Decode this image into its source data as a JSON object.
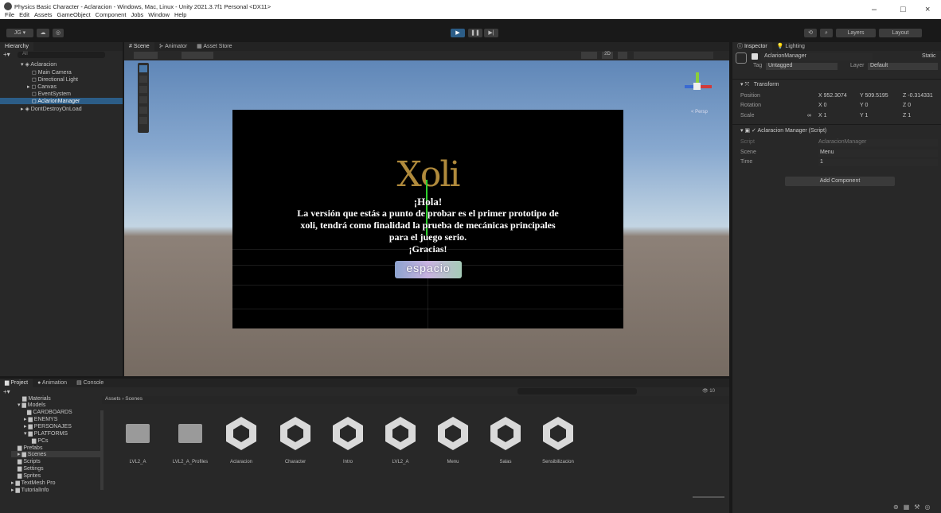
{
  "window": {
    "title": "Physics Basic Character - Aclaracion - Windows, Mac, Linux - Unity 2021.3.7f1 Personal <DX11>",
    "menu": [
      "File",
      "Edit",
      "Assets",
      "GameObject",
      "Component",
      "Jobs",
      "Window",
      "Help"
    ],
    "controls": [
      "–",
      "□",
      "×"
    ]
  },
  "toolbar": {
    "account": "JG ▾",
    "layers": "Layers",
    "layout": "Layout"
  },
  "hierarchy": {
    "tab": "Hierarchy",
    "search_placeholder": "All",
    "items": [
      "Aclaracion",
      "Main Camera",
      "Directional Light",
      "Canvas",
      "EventSystem",
      "AclarionManager",
      "DontDestroyOnLoad"
    ]
  },
  "scene_tabs": [
    "Scene",
    "Animator",
    "Asset Store"
  ],
  "scene_view": {
    "persp_label": "< Persp",
    "mode_2d": "2D"
  },
  "game": {
    "logo": "Xoli",
    "hello": "¡Hola!",
    "line1": "La versión que estás a punto de probar es el primer prototipo de",
    "line2": "xoli, tendrá como finalidad la prueba de mecánicas principales",
    "line3": "para el juego serio.",
    "thanks": "¡Gracias!",
    "button": "espacio"
  },
  "inspector": {
    "tabs": [
      "Inspector",
      "Lighting"
    ],
    "object_name": "AclarionManager",
    "static_label": "Static",
    "tag_label": "Tag",
    "tag_value": "Untagged",
    "layer_label": "Layer",
    "layer_value": "Default",
    "transform": {
      "title": "Transform",
      "position_label": "Position",
      "position": {
        "x": "952.3074",
        "y": "509.5195",
        "z": "-0.314331"
      },
      "rotation_label": "Rotation",
      "rotation": {
        "x": "0",
        "y": "0",
        "z": "0"
      },
      "scale_label": "Scale",
      "scale": {
        "x": "1",
        "y": "1",
        "z": "1"
      }
    },
    "script": {
      "title": "Aclaracion Manager (Script)",
      "script_label": "Script",
      "script_value": "AclaracionManager",
      "scene_label": "Scene",
      "scene_value": "Menu",
      "time_label": "Time",
      "time_value": "1"
    },
    "add_component": "Add Component"
  },
  "project": {
    "tabs": [
      "Project",
      "Animation",
      "Console"
    ],
    "tree": [
      "Materials",
      "Models",
      "CARDBOARDS",
      "ENEMYS",
      "PERSONAJES",
      "PLATFORMS",
      "PCs",
      "Prefabs",
      "Scenes",
      "Scripts",
      "Settings",
      "Sprites",
      "TextMesh Pro",
      "TutorialInfo"
    ],
    "breadcrumb": [
      "Assets",
      "Scenes"
    ],
    "assets": [
      "LVL2_A",
      "LVL2_A_Profiles",
      "Aclaracion",
      "Character",
      "Intro",
      "LVL2_A",
      "Menu",
      "Salas",
      "Sensibilizacion"
    ],
    "count": "10"
  }
}
